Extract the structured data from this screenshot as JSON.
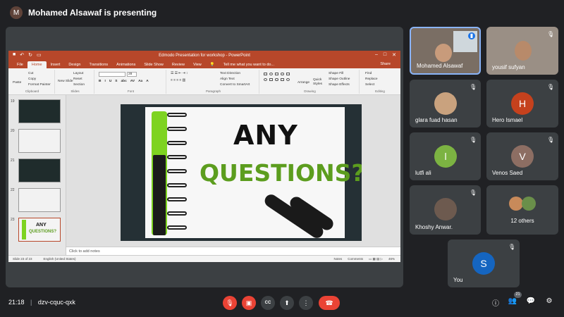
{
  "top": {
    "presenter_initial": "M",
    "presenter_text": "Mohamed Alsawaf is presenting"
  },
  "ppt": {
    "title": "Edmodo Presentation for workshop - PowerPoint",
    "tabs": [
      "File",
      "Home",
      "Insert",
      "Design",
      "Transitions",
      "Animations",
      "Slide Show",
      "Review",
      "View"
    ],
    "tell_me": "Tell me what you want to do...",
    "share": "Share",
    "clipboard": {
      "paste": "Paste",
      "cut": "Cut",
      "copy": "Copy",
      "format_painter": "Format Painter",
      "label": "Clipboard"
    },
    "slides_group": {
      "new_slide": "New Slide",
      "layout": "Layout",
      "reset": "Reset",
      "section": "Section",
      "label": "Slides"
    },
    "font_label": "Font",
    "font_size": "28",
    "font_buttons": [
      "B",
      "I",
      "U",
      "S",
      "abc",
      "AV",
      "Aa",
      "A"
    ],
    "paragraph": {
      "text_direction": "Text Direction",
      "align_text": "Align Text",
      "smartart": "Convert to SmartArt",
      "label": "Paragraph"
    },
    "drawing": {
      "arrange": "Arrange",
      "quick_styles": "Quick Styles",
      "fill": "Shape Fill",
      "outline": "Shape Outline",
      "effects": "Shape Effects",
      "label": "Drawing"
    },
    "editing": {
      "find": "Find",
      "replace": "Replace",
      "select": "Select",
      "label": "Editing"
    },
    "thumbs": [
      {
        "num": "19",
        "style": "dark"
      },
      {
        "num": "20",
        "style": "light"
      },
      {
        "num": "21",
        "style": "dark"
      },
      {
        "num": "22",
        "style": "light"
      },
      {
        "num": "23",
        "style": "selected"
      }
    ],
    "slide": {
      "line1": "ANY",
      "line2": "QUESTIONS?"
    },
    "notes_placeholder": "Click to add notes",
    "status": {
      "slide_count": "Slide 23 of 23",
      "language": "English (United States)",
      "notes": "Notes",
      "comments": "Comments",
      "zoom": "46%"
    }
  },
  "participants": [
    {
      "name": "Mohamed Alsawaf",
      "type": "video",
      "speaking": true
    },
    {
      "name": "yousif sufyan",
      "type": "video",
      "muted": true
    },
    {
      "name": "glara fuad hasan",
      "type": "photo",
      "muted": true
    },
    {
      "name": "Hero Ismael",
      "initial": "H",
      "color": "#c5411d",
      "muted": true
    },
    {
      "name": "lutfi ali",
      "initial": "l",
      "color": "#7cb342",
      "muted": true
    },
    {
      "name": "Venos Saed",
      "initial": "V",
      "color": "#8d6e63",
      "muted": true
    },
    {
      "name": "Khoshy Anwar.",
      "type": "photo",
      "muted": true
    },
    {
      "name": "12 others",
      "type": "group"
    },
    {
      "name": "You",
      "initial": "S",
      "color": "#1565c0",
      "muted": true
    }
  ],
  "bottom": {
    "time": "21:18",
    "separator": "|",
    "meeting_code": "dzv-cquc-qxk",
    "participant_count": "21"
  },
  "colors": {
    "accent_red": "#ea4335",
    "ppt_red": "#b7472a",
    "bg": "#202124",
    "tile": "#3c4043",
    "speaking_border": "#8ab4f8"
  }
}
